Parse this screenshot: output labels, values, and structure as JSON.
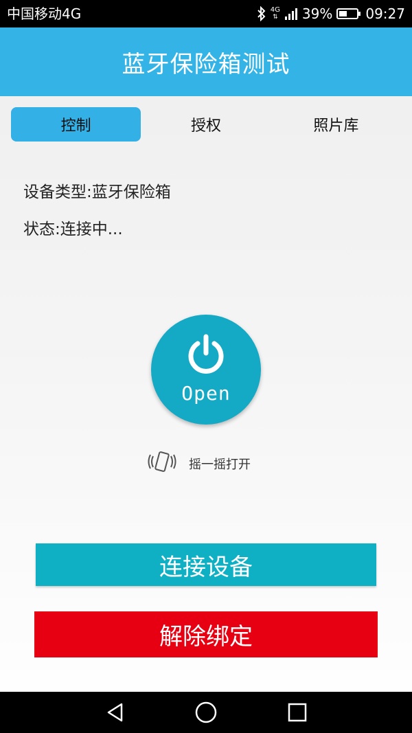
{
  "status_bar": {
    "carrier": "中国移动4G",
    "network_tag_top": "4G",
    "battery": "39%",
    "time": "09:27",
    "icons": [
      "bluetooth-icon",
      "signal-icon",
      "battery-icon"
    ]
  },
  "header": {
    "title": "蓝牙保险箱测试"
  },
  "tabs": [
    {
      "label": "控制",
      "active": true
    },
    {
      "label": "授权",
      "active": false
    },
    {
      "label": "照片库",
      "active": false
    }
  ],
  "device": {
    "type_text": "设备类型:蓝牙保险箱",
    "status_text": "状态:连接中..."
  },
  "open_button": {
    "label": "Open",
    "icon": "power-icon"
  },
  "shake": {
    "label": "摇一摇打开",
    "icon": "phone-shake-icon"
  },
  "buttons": {
    "connect": "连接设备",
    "unbind": "解除绑定"
  },
  "nav": {
    "icons": [
      "back-triangle-icon",
      "home-circle-icon",
      "recent-square-icon"
    ]
  },
  "colors": {
    "header": "#33b3e6",
    "tab_active": "#33b0e6",
    "open_button": "#14a9c4",
    "connect_button": "#0fb0c4",
    "unbind_button": "#e60012"
  }
}
